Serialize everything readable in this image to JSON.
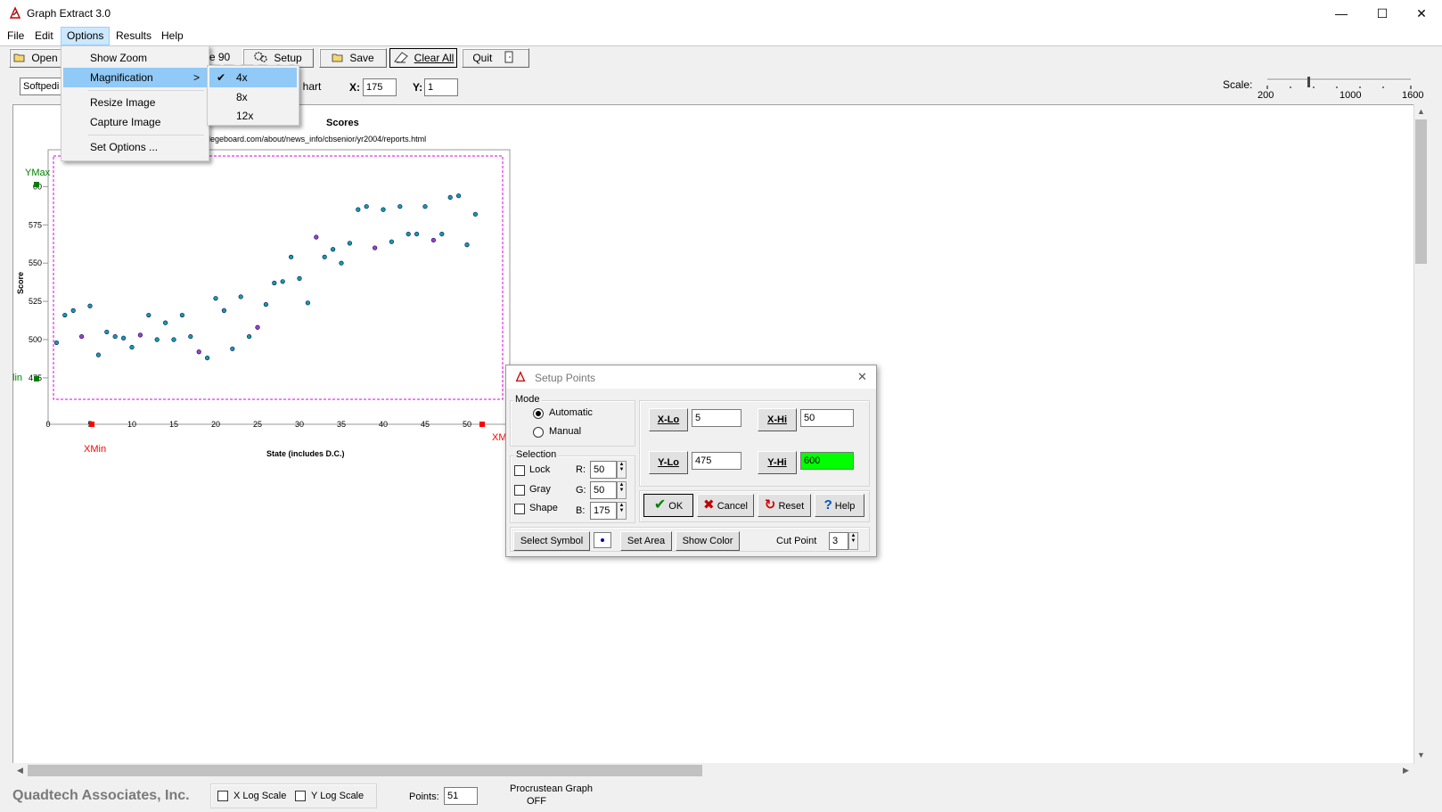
{
  "app": {
    "title": "Graph Extract 3.0",
    "window_controls": {
      "minimize": "—",
      "maximize": "☐",
      "close": "✕"
    }
  },
  "menubar": [
    "File",
    "Edit",
    "Options",
    "Results",
    "Help"
  ],
  "toolbar": {
    "open": "Open",
    "rotate": "e 90",
    "setup": "Setup",
    "save": "Save",
    "clear_all": "Clear All",
    "quit": "Quit",
    "image_field": "Softpedi",
    "chart_btn": "hart",
    "x_label": "X:",
    "x_value": "175",
    "y_label": "Y:",
    "y_value": "1",
    "scale_label": "Scale:",
    "scale_ticks": [
      "200",
      "1000",
      "1600"
    ]
  },
  "options_menu": {
    "items": [
      "Show Zoom",
      "Magnification",
      "Resize Image",
      "Capture Image",
      "Set Options ..."
    ],
    "submenu_arrow": ">"
  },
  "magnification_submenu": {
    "items": [
      "4x",
      "8x",
      "12x"
    ],
    "checked": "4x"
  },
  "watermark": "SOFTPEDIA",
  "chart_data": {
    "type": "scatter",
    "title": "Scores",
    "subtitle": "llegeboard.com/about/news_info/cbsenior/yr2004/reports.html",
    "xlabel": "State (includes D.C.)",
    "ylabel": "Score",
    "xlim": [
      0,
      50
    ],
    "ylim": [
      470,
      605
    ],
    "x_ticks": [
      "0",
      "5",
      "10",
      "15",
      "20",
      "25",
      "30",
      "35",
      "40",
      "45",
      "50"
    ],
    "y_ticks": [
      "500",
      "525",
      "550",
      "575",
      "600"
    ],
    "y_tick_labels": [
      "475",
      "500",
      "525",
      "550",
      "575",
      "00"
    ],
    "markers": {
      "ymax": "YMax",
      "ymin": "lin",
      "xmin": "XMin",
      "xmax": "XM"
    },
    "points": [
      [
        1,
        498
      ],
      [
        2,
        516
      ],
      [
        3,
        519
      ],
      [
        4,
        502
      ],
      [
        5,
        522
      ],
      [
        6,
        490
      ],
      [
        7,
        505
      ],
      [
        8,
        502
      ],
      [
        9,
        501
      ],
      [
        10,
        495
      ],
      [
        11,
        503
      ],
      [
        12,
        516
      ],
      [
        13,
        500
      ],
      [
        14,
        511
      ],
      [
        15,
        500
      ],
      [
        16,
        516
      ],
      [
        17,
        502
      ],
      [
        18,
        492
      ],
      [
        19,
        488
      ],
      [
        20,
        527
      ],
      [
        21,
        519
      ],
      [
        22,
        494
      ],
      [
        23,
        528
      ],
      [
        24,
        502
      ],
      [
        25,
        508
      ],
      [
        26,
        523
      ],
      [
        27,
        537
      ],
      [
        28,
        538
      ],
      [
        29,
        554
      ],
      [
        30,
        540
      ],
      [
        31,
        524
      ],
      [
        32,
        567
      ],
      [
        33,
        554
      ],
      [
        34,
        559
      ],
      [
        35,
        550
      ],
      [
        36,
        563
      ],
      [
        37,
        585
      ],
      [
        38,
        587
      ],
      [
        39,
        560
      ],
      [
        40,
        585
      ],
      [
        41,
        564
      ],
      [
        42,
        587
      ],
      [
        43,
        569
      ],
      [
        44,
        569
      ],
      [
        45,
        587
      ],
      [
        46,
        565
      ],
      [
        47,
        569
      ],
      [
        48,
        593
      ],
      [
        49,
        594
      ],
      [
        50,
        562
      ],
      [
        51,
        582
      ]
    ]
  },
  "dialog": {
    "title": "Setup Points",
    "close": "✕",
    "mode_label": "Mode",
    "mode_automatic": "Automatic",
    "mode_manual": "Manual",
    "selection_label": "Selection",
    "lock": "Lock",
    "gray": "Gray",
    "shape": "Shape",
    "r_label": "R:",
    "r_value": "50",
    "g_label": "G:",
    "g_value": "50",
    "b_label": "B:",
    "b_value": "175",
    "xlo_label": "X-Lo",
    "xlo_value": "5",
    "xhi_label": "X-Hi",
    "xhi_value": "50",
    "ylo_label": "Y-Lo",
    "ylo_value": "475",
    "yhi_label": "Y-Hi",
    "yhi_value": "600",
    "ok": "OK",
    "cancel": "Cancel",
    "reset": "Reset",
    "help": "Help",
    "select_symbol": "Select Symbol",
    "set_area": "Set Area",
    "show_color": "Show Color",
    "cut_point_label": "Cut Point",
    "cut_point_value": "3",
    "yhi_color": "#00ff00"
  },
  "statusbar": {
    "company": "Quadtech Associates, Inc.",
    "x_log": "X Log Scale",
    "y_log": "Y Log Scale",
    "points_label": "Points:",
    "points_value": "51",
    "procrustean": "Procrustean Graph",
    "procrustean_state": "OFF"
  }
}
